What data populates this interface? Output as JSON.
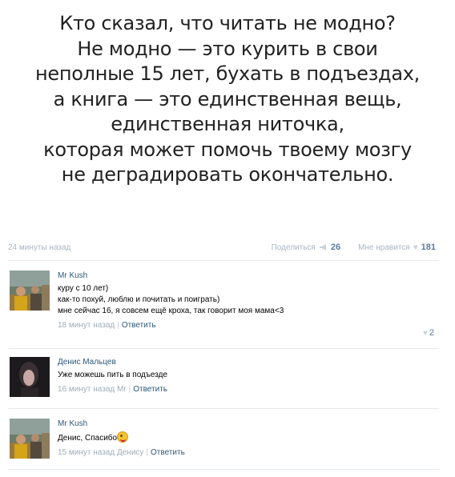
{
  "post": {
    "quote_lines": [
      "Кто сказал, что читать не модно?",
      "Не модно — это курить в свои",
      "неполные 15 лет, бухать в подъездах,",
      "а книга — это единственная вещь,",
      "единственная ниточка,",
      "которая может помочь твоему мозгу",
      "не деградировать окончательно."
    ],
    "time": "24 минуты назад",
    "share_label": "Поделиться",
    "share_count": "26",
    "like_label": "Мне нравится",
    "like_count": "181"
  },
  "comments": [
    {
      "author": "Mr Kush",
      "lines": [
        "куру с 10 лет)",
        "как-то похуй, люблю и почитать и поиграть)",
        "мне сейчас 16, я совсем ещё кроха, так говорит моя мама<3"
      ],
      "time": "18 минут назад",
      "reply_label": "Ответить",
      "likes": "2"
    },
    {
      "author": "Денис Мальцев",
      "lines": [
        "Уже можешь пить в подъезде"
      ],
      "time": "16 минут назад Mr",
      "reply_label": "Ответить",
      "likes": ""
    },
    {
      "author": "Mr Kush",
      "lines": [
        "Денис, Спасибо"
      ],
      "time": "15 минут назад Денису",
      "reply_label": "Ответить",
      "likes": ""
    }
  ],
  "icons": {
    "share": "megaphone-icon",
    "like": "heart-icon",
    "emoji": "smile-emoji-icon"
  },
  "colors": {
    "link": "#2b587a",
    "meta": "#a0acb8",
    "count": "#5b7ba2",
    "quote_text": "#222222"
  }
}
